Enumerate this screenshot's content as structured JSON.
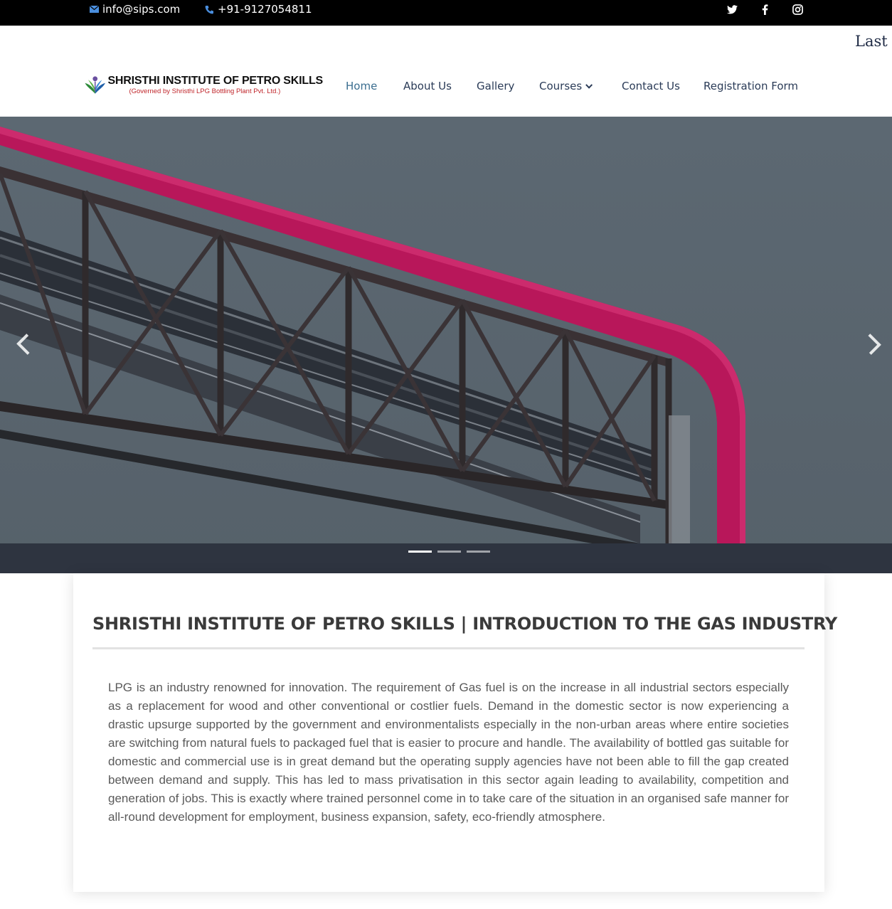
{
  "topbar": {
    "email": "info@sips.com",
    "phone": "+91-9127054811",
    "email_icon": "envelope-icon",
    "phone_icon": "phone-icon",
    "social": [
      "twitter-icon",
      "facebook-icon",
      "instagram-icon"
    ]
  },
  "header": {
    "marquee": "Last d",
    "logo": {
      "name": "SHRISTHI INSTITUTE OF PETRO SKILLS",
      "tagline": "(Governed by Shristhi LPG Bottling Plant Pvt. Ltd.)"
    },
    "nav": [
      {
        "label": "Home",
        "active": true
      },
      {
        "label": "About Us"
      },
      {
        "label": "Gallery"
      },
      {
        "label": "Courses",
        "dropdown": true
      },
      {
        "label": "Contact Us"
      },
      {
        "label": "Registration Form"
      }
    ]
  },
  "slider": {
    "slide_count": 3,
    "active_slide": 1
  },
  "content": {
    "title": "SHRISTHI INSTITUTE OF PETRO SKILLS | INTRODUCTION TO THE GAS INDUSTRY",
    "body": "LPG is an industry renowned for innovation. The requirement of Gas fuel is on the increase in all industrial sectors especially as a replacement for wood and other conventional or costlier fuels. Demand in the domestic sector is now experiencing a drastic upsurge supported by the government and environmentalists especially in the non-urban areas where entire societies are switching from natural fuels to packaged fuel that is easier to procure and handle. The availability of bottled gas suitable for domestic and commercial use is in great demand but the operating supply agencies have not been able to fill the gap created between demand and supply. This has led to mass privatisation in this sector again leading to availability, competition and generation of jobs. This is exactly where trained personnel come in to take care of the situation in an organised safe manner for all-round development for employment, business expansion, safety, eco-friendly atmosphere."
  },
  "colors": {
    "topbar": "#000000",
    "nav_text": "#2a3b57",
    "nav_active": "#3a6d8f",
    "logo_tagline": "#c0262b",
    "hero_sky": "#5a6670",
    "pipe_red": "#c2185b",
    "body_text": "#5a5a5a"
  }
}
